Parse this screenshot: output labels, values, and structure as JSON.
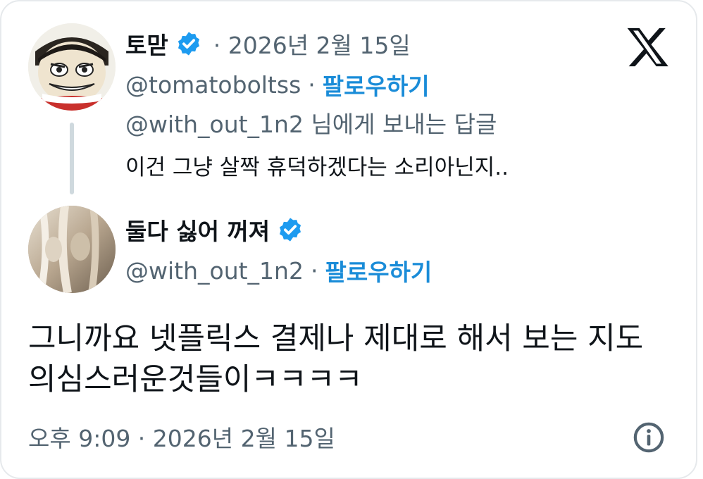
{
  "quoted_tweet": {
    "display_name": "토맏",
    "date": "· 2026년 2월 15일",
    "handle": "@tomatoboltss",
    "separator": "·",
    "follow_label": "팔로우하기",
    "replying_to": "@with_out_1n2 님에게 보내는 답글",
    "text": "이건 그냥 살짝 휴덕하겠다는 소리아닌지.."
  },
  "main_tweet": {
    "display_name": "둘다 싫어 꺼져",
    "handle": "@with_out_1n2",
    "separator": "·",
    "follow_label": "팔로우하기",
    "text": "그니까요 넷플릭스 결제나 제대로 해서 보는 지도 의심스러운것들이ㅋㅋㅋㅋ",
    "timestamp": "오후 9:09 · 2026년 2월 15일"
  },
  "icons": {
    "brand": "x-logo-icon",
    "verified": "verified-badge-icon",
    "info": "info-icon"
  },
  "colors": {
    "accent": "#1d9bf0",
    "secondary_text": "#536471",
    "primary_text": "#0f1419",
    "thread_line": "#cfd9de"
  }
}
